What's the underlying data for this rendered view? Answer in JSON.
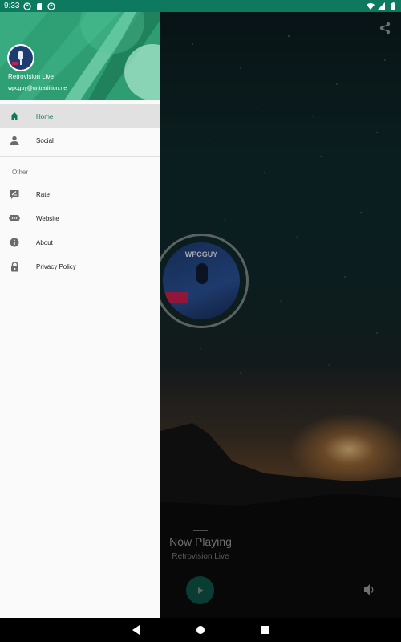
{
  "status_bar": {
    "time": "9:33"
  },
  "drawer": {
    "header": {
      "app_name": "Retrovision Live",
      "email": "wpcguy@untradition.ne"
    },
    "items": [
      {
        "label": "Home",
        "icon": "home-icon"
      },
      {
        "label": "Social",
        "icon": "person-icon"
      }
    ],
    "section_label": "Other",
    "other_items": [
      {
        "label": "Rate",
        "icon": "rate-review-icon"
      },
      {
        "label": "Website",
        "icon": "web-icon"
      },
      {
        "label": "About",
        "icon": "info-icon"
      },
      {
        "label": "Privacy Policy",
        "icon": "lock-icon"
      }
    ]
  },
  "player": {
    "album_title": "WPCGUY",
    "now_playing": "Now Playing",
    "station": "Retrovision Live"
  },
  "colors": {
    "accent": "#0d7a5f",
    "status_bar": "#0d7a5f",
    "header": "#2e9e72"
  }
}
